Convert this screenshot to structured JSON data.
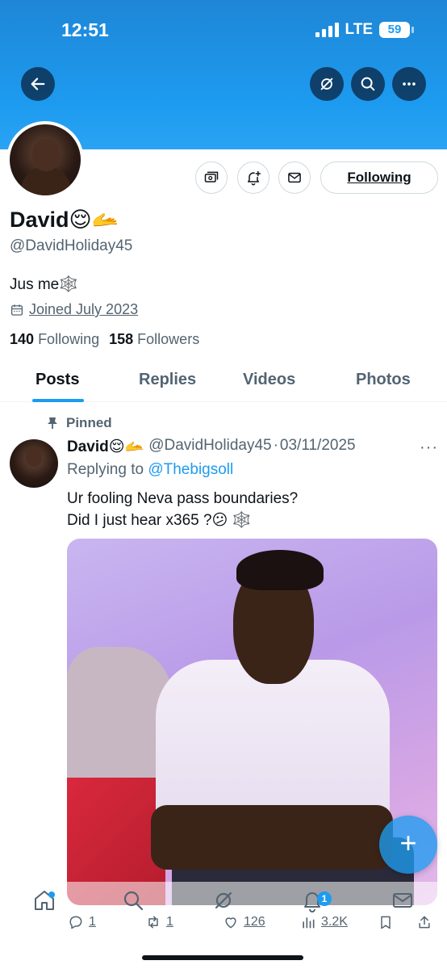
{
  "status_bar": {
    "time": "12:51",
    "network": "LTE",
    "battery": "59"
  },
  "header": {
    "back_icon": "arrow-left-icon",
    "grok_icon": "grok-icon",
    "search_icon": "search-icon",
    "more_icon": "ellipsis-icon",
    "accent": "#1d9bf0"
  },
  "profile": {
    "name": "David😌🫴",
    "handle": "@DavidHoliday45",
    "bio": "Jus me🕸️",
    "joined": "Joined July 2023",
    "following_count": "140",
    "following_label": "Following",
    "followers_count": "158",
    "followers_label": "Followers",
    "follow_button": "Following"
  },
  "tabs": [
    {
      "label": "Posts",
      "active": true
    },
    {
      "label": "Replies",
      "active": false
    },
    {
      "label": "Videos",
      "active": false
    },
    {
      "label": "Photos",
      "active": false
    }
  ],
  "post": {
    "pinned_label": "Pinned",
    "author_name": "David😌🫴",
    "author_handle": "@DavidHoliday45",
    "separator": "·",
    "date": "03/11/2025",
    "replying_prefix": "Replying to",
    "replying_to": "@Thebigsoll",
    "text_line1": "Ur fooling Neva pass boundaries?",
    "text_line2": "Did I just hear x365 ?😕 🕸️",
    "reply_count": "1",
    "repost_count": "1",
    "like_count": "126",
    "view_count": "3.2K"
  },
  "bottom_nav": {
    "notification_badge": "1"
  },
  "fab": {
    "label": "+"
  }
}
